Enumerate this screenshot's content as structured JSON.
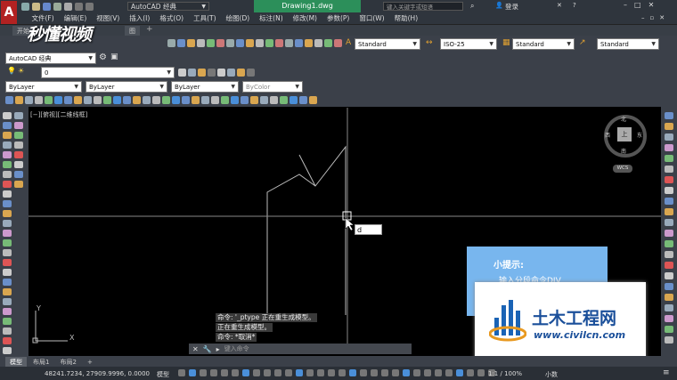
{
  "titlebar": {
    "workspace": "AutoCAD 经典",
    "doc_title": "Drawing1.dwg",
    "search_placeholder": "键入关键字或短语",
    "login": "登录",
    "help": "?"
  },
  "watermark_top": "秒懂视频",
  "menu": [
    "文件(F)",
    "编辑(E)",
    "视图(V)",
    "插入(I)",
    "格式(O)",
    "工具(T)",
    "绘图(D)",
    "标注(N)",
    "修改(M)",
    "参数(P)",
    "窗口(W)",
    "帮助(H)"
  ],
  "doc_tabs": [
    "开始",
    "图"
  ],
  "ribbon": {
    "workspace_select": "AutoCAD 经典",
    "layer_select": "0",
    "text_style": "Standard",
    "dim_style": "ISO-25",
    "table_style": "Standard",
    "multileader_style": "Standard",
    "color": "ByLayer",
    "linetype": "ByLayer",
    "lineweight": "ByLayer",
    "plotstyle": "ByColor"
  },
  "viewport_label": "[−][俯视][二维线框]",
  "viewcube": {
    "north": "北",
    "south": "南",
    "east": "东",
    "west": "西",
    "top": "上",
    "wcs": "WCS"
  },
  "ucs": {
    "x": "X",
    "y": "Y"
  },
  "dynamic_input": "d",
  "command_history": [
    "命令: '_ptype 正在重生成模型。",
    "正在重生成模型。",
    "命令: *取消*"
  ],
  "command_placeholder": "键入命令",
  "tip": {
    "title": "小提示:",
    "line": "输入分段命令DIV"
  },
  "brand": {
    "name": "土木工程网",
    "url": "www.civilcn.com"
  },
  "layout_tabs": [
    "模型",
    "布局1",
    "布局2",
    "+"
  ],
  "status": {
    "coords": "48241.7234, 27909.9996, 0.0000",
    "model": "模型",
    "scale": "1:1 / 100%",
    "units": "小数"
  }
}
